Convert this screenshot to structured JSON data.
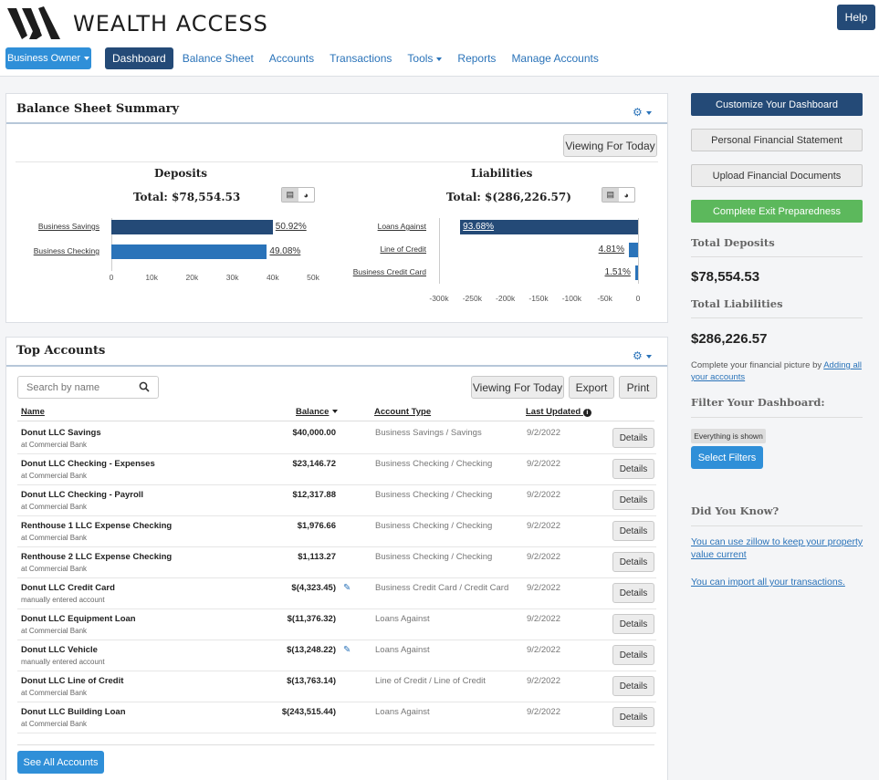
{
  "brand": {
    "name": "WEALTH ACCESS"
  },
  "header": {
    "help_label": "Help",
    "business_owner_label": "Business Owner",
    "nav": [
      {
        "label": "Dashboard",
        "active": true
      },
      {
        "label": "Balance Sheet"
      },
      {
        "label": "Accounts"
      },
      {
        "label": "Transactions"
      },
      {
        "label": "Tools",
        "dropdown": true
      },
      {
        "label": "Reports"
      },
      {
        "label": "Manage Accounts"
      }
    ]
  },
  "balance_sheet": {
    "title": "Balance Sheet Summary",
    "viewing_label": "Viewing For Today",
    "deposits": {
      "title": "Deposits",
      "total": "Total: $78,554.53",
      "categories": [
        "Business Savings",
        "Business Checking"
      ],
      "pct_labels": [
        "50.92%",
        "49.08%"
      ],
      "ticks": [
        "0",
        "10k",
        "20k",
        "30k",
        "40k",
        "50k"
      ]
    },
    "liabilities": {
      "title": "Liabilities",
      "total": "Total: $(286,226.57)",
      "categories": [
        "Loans Against",
        "Line of Credit",
        "Business Credit Card"
      ],
      "pct_labels": [
        "93.68%",
        "4.81%",
        "1.51%"
      ],
      "ticks": [
        "-300k",
        "-250k",
        "-200k",
        "-150k",
        "-100k",
        "-50k",
        "0"
      ]
    }
  },
  "chart_data": [
    {
      "type": "bar",
      "title": "Deposits",
      "categories": [
        "Business Savings",
        "Business Checking"
      ],
      "values": [
        40000.0,
        38554.53
      ],
      "labels": [
        "50.92%",
        "49.08%"
      ],
      "xlim": [
        0,
        50000
      ],
      "colors": [
        "#244a77",
        "#2a73b9"
      ]
    },
    {
      "type": "bar",
      "title": "Liabilities",
      "categories": [
        "Loans Against",
        "Line of Credit",
        "Business Credit Card"
      ],
      "values": [
        -268140,
        -13763.14,
        -4323.45
      ],
      "labels": [
        "93.68%",
        "4.81%",
        "1.51%"
      ],
      "xlim": [
        -300000,
        0
      ],
      "colors": [
        "#244a77",
        "#2a73b9",
        "#2a73b9"
      ]
    }
  ],
  "top_accounts": {
    "title": "Top Accounts",
    "search_placeholder": "Search by name",
    "viewing_label": "Viewing For Today",
    "export_label": "Export",
    "print_label": "Print",
    "columns": {
      "name": "Name",
      "balance": "Balance",
      "type": "Account Type",
      "updated": "Last Updated"
    },
    "details_label": "Details",
    "see_all_label": "See All Accounts",
    "rows": [
      {
        "name": "Donut LLC Savings",
        "sub": "at Commercial Bank",
        "balance": "$40,000.00",
        "type": "Business Savings / Savings",
        "date": "9/2/2022",
        "editable": false
      },
      {
        "name": "Donut LLC Checking - Expenses",
        "sub": "at Commercial Bank",
        "balance": "$23,146.72",
        "type": "Business Checking / Checking",
        "date": "9/2/2022",
        "editable": false
      },
      {
        "name": "Donut LLC Checking - Payroll",
        "sub": "at Commercial Bank",
        "balance": "$12,317.88",
        "type": "Business Checking / Checking",
        "date": "9/2/2022",
        "editable": false
      },
      {
        "name": "Renthouse 1 LLC Expense Checking",
        "sub": "at Commercial Bank",
        "balance": "$1,976.66",
        "type": "Business Checking / Checking",
        "date": "9/2/2022",
        "editable": false
      },
      {
        "name": "Renthouse 2 LLC Expense Checking",
        "sub": "at Commercial Bank",
        "balance": "$1,113.27",
        "type": "Business Checking / Checking",
        "date": "9/2/2022",
        "editable": false
      },
      {
        "name": "Donut LLC Credit Card",
        "sub": "manually entered account",
        "balance": "$(4,323.45)",
        "type": "Business Credit Card / Credit Card",
        "date": "9/2/2022",
        "editable": true
      },
      {
        "name": "Donut LLC Equipment Loan",
        "sub": "at Commercial Bank",
        "balance": "$(11,376.32)",
        "type": "Loans Against",
        "date": "9/2/2022",
        "editable": false
      },
      {
        "name": "Donut LLC Vehicle",
        "sub": "manually entered account",
        "balance": "$(13,248.22)",
        "type": "Loans Against",
        "date": "9/2/2022",
        "editable": true
      },
      {
        "name": "Donut LLC Line of Credit",
        "sub": "at Commercial Bank",
        "balance": "$(13,763.14)",
        "type": "Line of Credit / Line of Credit",
        "date": "9/2/2022",
        "editable": false
      },
      {
        "name": "Donut LLC Building Loan",
        "sub": "at Commercial Bank",
        "balance": "$(243,515.44)",
        "type": "Loans Against",
        "date": "9/2/2022",
        "editable": false
      }
    ]
  },
  "sidebar": {
    "customize_label": "Customize Your Dashboard",
    "pfs_label": "Personal Financial Statement",
    "upload_label": "Upload Financial Documents",
    "exit_label": "Complete Exit Preparedness",
    "total_deposits_label": "Total Deposits",
    "total_deposits_value": "$78,554.53",
    "total_liabilities_label": "Total Liabilities",
    "total_liabilities_value": "$286,226.57",
    "complete_text": "Complete your financial picture by ",
    "complete_link": "Adding all your accounts",
    "filter_title": "Filter Your Dashboard:",
    "filter_badge": "Everything is shown",
    "select_filters_label": "Select Filters",
    "did_you_know": "Did You Know?",
    "tip1": "You can use zillow to keep your property value current",
    "tip2": "You can import all your transactions."
  },
  "colors": {
    "navy": "#244a77",
    "blue": "#2a73b9",
    "bright_blue": "#2f8fd8",
    "green": "#5cb85c"
  }
}
